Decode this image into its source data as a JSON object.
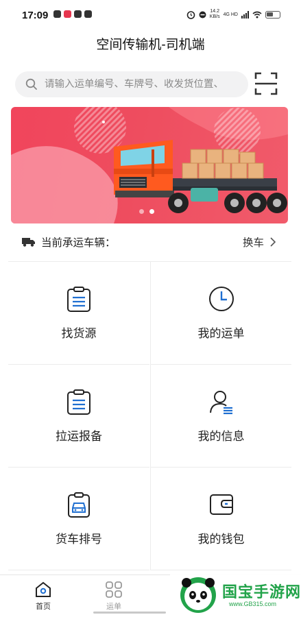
{
  "status_bar": {
    "time": "17:09",
    "speed": "14.2",
    "speed_unit": "KB/s",
    "network": "4G HD"
  },
  "header": {
    "title": "空间传输机-司机端"
  },
  "search": {
    "placeholder": "请输入运单编号、车牌号、收发货位置、"
  },
  "banner": {
    "slide_count": 2,
    "active_slide": 1
  },
  "vehicle": {
    "label": "当前承运车辆：",
    "change_label": "换车"
  },
  "menu": [
    {
      "label": "找货源",
      "icon": "clipboard-list-icon"
    },
    {
      "label": "我的运单",
      "icon": "clock-icon"
    },
    {
      "label": "拉运报备",
      "icon": "clipboard-list-icon"
    },
    {
      "label": "我的信息",
      "icon": "user-info-icon"
    },
    {
      "label": "货车排号",
      "icon": "truck-queue-icon"
    },
    {
      "label": "我的钱包",
      "icon": "wallet-icon"
    }
  ],
  "tabbar": {
    "home_label": "首页",
    "orders_label": "运单"
  },
  "watermark": {
    "brand": "国宝手游网",
    "url": "www.GB315.com"
  },
  "colors": {
    "accent": "#1f6fd1",
    "banner_red": "#ee4d5f",
    "truck_orange": "#ff5a1f",
    "watermark_green": "#22a34a"
  }
}
